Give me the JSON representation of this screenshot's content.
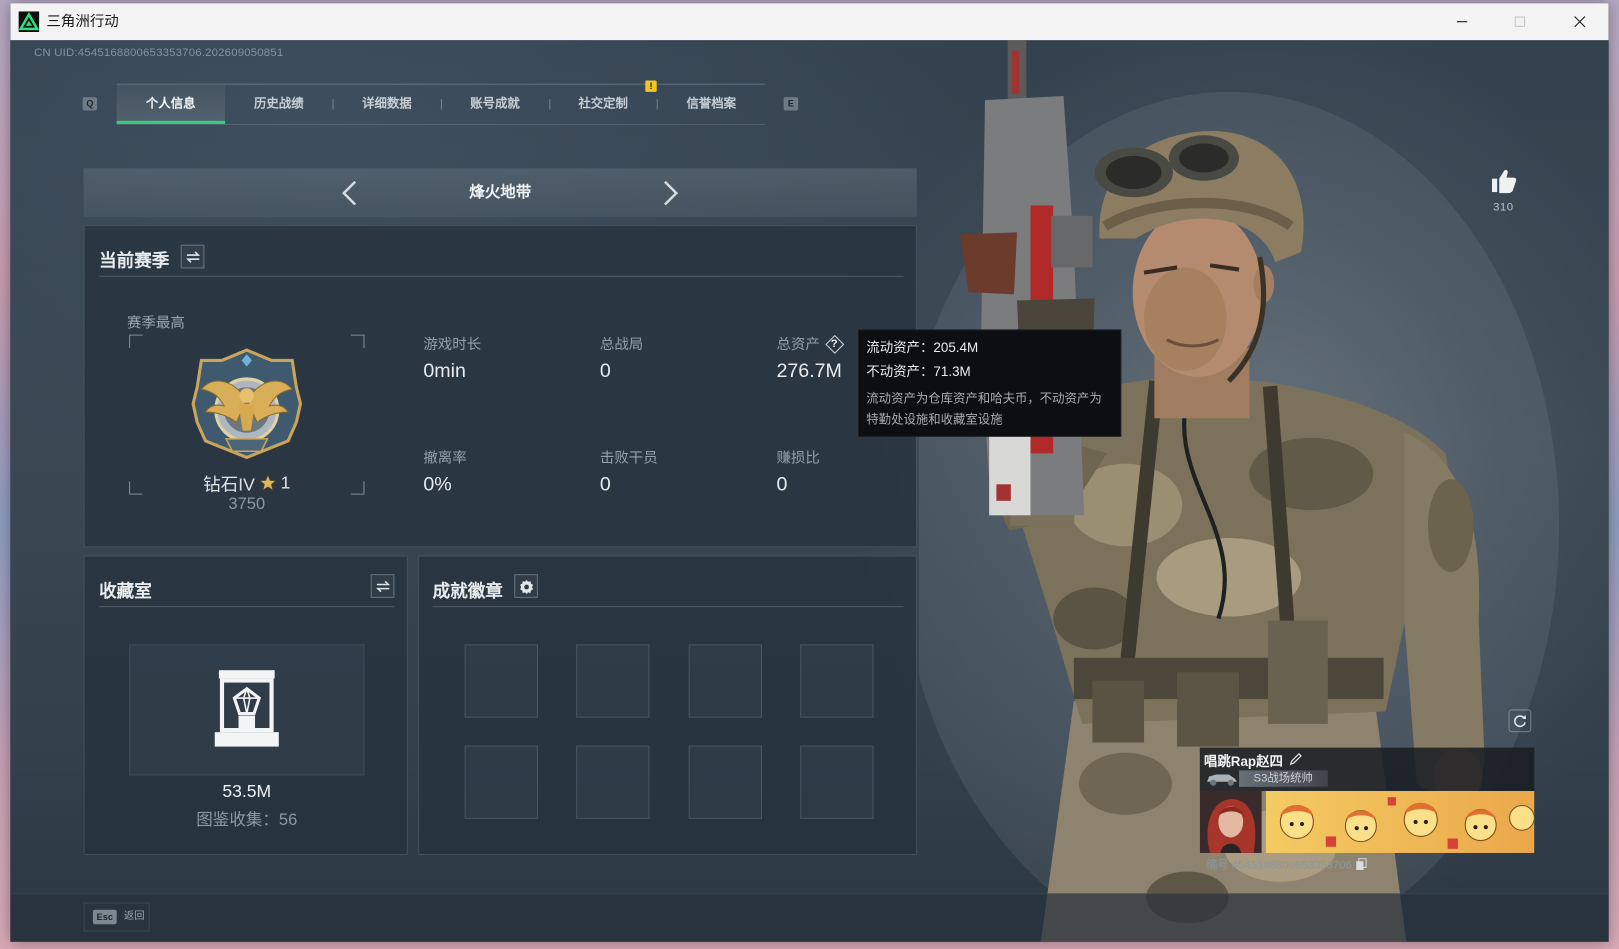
{
  "window": {
    "title": "三角洲行动"
  },
  "header": {
    "uid_text": "CN UID:4545168800653353706.202609050851"
  },
  "tabs": {
    "prev_key": "Q",
    "next_key": "E",
    "items": [
      {
        "label": "个人信息",
        "active": true
      },
      {
        "label": "历史战绩",
        "active": false
      },
      {
        "label": "详细数据",
        "active": false
      },
      {
        "label": "账号成就",
        "active": false
      },
      {
        "label": "社交定制",
        "active": false,
        "has_alert_badge": true
      },
      {
        "label": "信誉档案",
        "active": false
      }
    ]
  },
  "mode_selector": {
    "label": "烽火地带"
  },
  "season": {
    "title": "当前赛季",
    "best_label": "赛季最高",
    "rank_name": "钻石IV",
    "rank_stars": "1",
    "rank_points": "3750",
    "stats": [
      {
        "label": "游戏时长",
        "value": "0min"
      },
      {
        "label": "总战局",
        "value": "0"
      },
      {
        "label": "总资产",
        "value": "276.7M"
      },
      {
        "label": "撤离率",
        "value": "0%"
      },
      {
        "label": "击败干员",
        "value": "0"
      },
      {
        "label": "赚损比",
        "value": "0"
      }
    ]
  },
  "asset_tooltip": {
    "liquid": "流动资产：205.4M",
    "fixed": "不动资产：71.3M",
    "note": "流动资产为仓库资产和哈夫币，不动资产为特勤处设施和收藏室设施"
  },
  "collection_room": {
    "title": "收藏室",
    "value": "53.5M",
    "catalog": "图鉴收集：56"
  },
  "achievement_badges": {
    "title": "成就徽章"
  },
  "likes": {
    "count": "310"
  },
  "player_card": {
    "name": "唱跳Rap赵四",
    "title_badge": "S3战场统帅",
    "id_text": "编号 4545168800653353706"
  },
  "footer": {
    "esc_key": "Esc",
    "back_label": "返回"
  },
  "colors": {
    "accent_green": "#35d07f",
    "alert_yellow": "#f3c623",
    "panel_bg": "#24303c",
    "tooltip_bg": "#0c0e11"
  },
  "icons": [
    "triangle-logo-icon",
    "minimize-icon",
    "maximize-icon",
    "close-icon",
    "chevron-left-icon",
    "chevron-right-icon",
    "swap-icon",
    "question-icon",
    "star-icon",
    "gear-icon",
    "thumbs-up-icon",
    "refresh-icon",
    "edit-icon",
    "copy-icon",
    "vehicle-icon"
  ]
}
